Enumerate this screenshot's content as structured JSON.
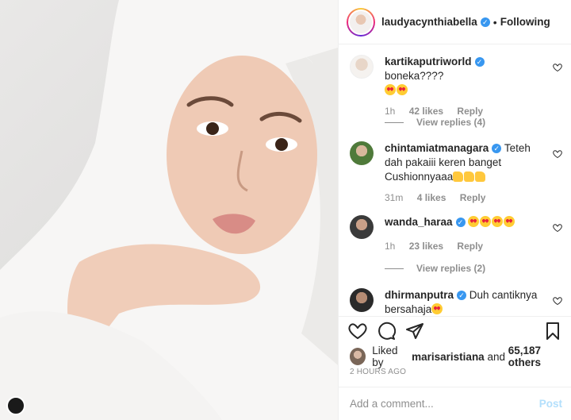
{
  "header": {
    "username": "laudyacynthiabella",
    "separator": "•",
    "follow_label": "Following",
    "verified_icon": "verified-badge-icon"
  },
  "comments": [
    {
      "username": "kartikaputriworld",
      "verified": true,
      "text": "boneka????",
      "emoji": [
        "heart-eyes",
        "heart-eyes"
      ],
      "time": "1h",
      "likes": "42 likes",
      "reply": "Reply",
      "view_replies": "View replies (4)"
    },
    {
      "username": "chintamiatmanagara",
      "verified": true,
      "text": "Teteh dah pakaiii keren banget Cushionnyaaa",
      "emoji": [
        "thumbs-up",
        "thumbs-up",
        "thumbs-up"
      ],
      "time": "31m",
      "likes": "4 likes",
      "reply": "Reply"
    },
    {
      "username": "wanda_haraa",
      "verified": true,
      "text": "",
      "emoji": [
        "heart-eyes",
        "heart-eyes",
        "heart-eyes",
        "heart-eyes"
      ],
      "time": "1h",
      "likes": "23 likes",
      "reply": "Reply",
      "view_replies": "View replies (2)"
    },
    {
      "username": "dhirmanputra",
      "verified": true,
      "text": "Duh cantiknya bersahaja",
      "emoji": [
        "heart-eyes"
      ]
    }
  ],
  "likes": {
    "prefix": "Liked by",
    "user": "marisaristiana",
    "connector": "and",
    "others": "65,187 others"
  },
  "timestamp": "2 HOURS AGO",
  "composer": {
    "placeholder": "Add a comment...",
    "post_label": "Post"
  },
  "colors": {
    "verified": "#3897f0",
    "muted": "#8e8e8e",
    "post_disabled": "#b2dffc"
  }
}
